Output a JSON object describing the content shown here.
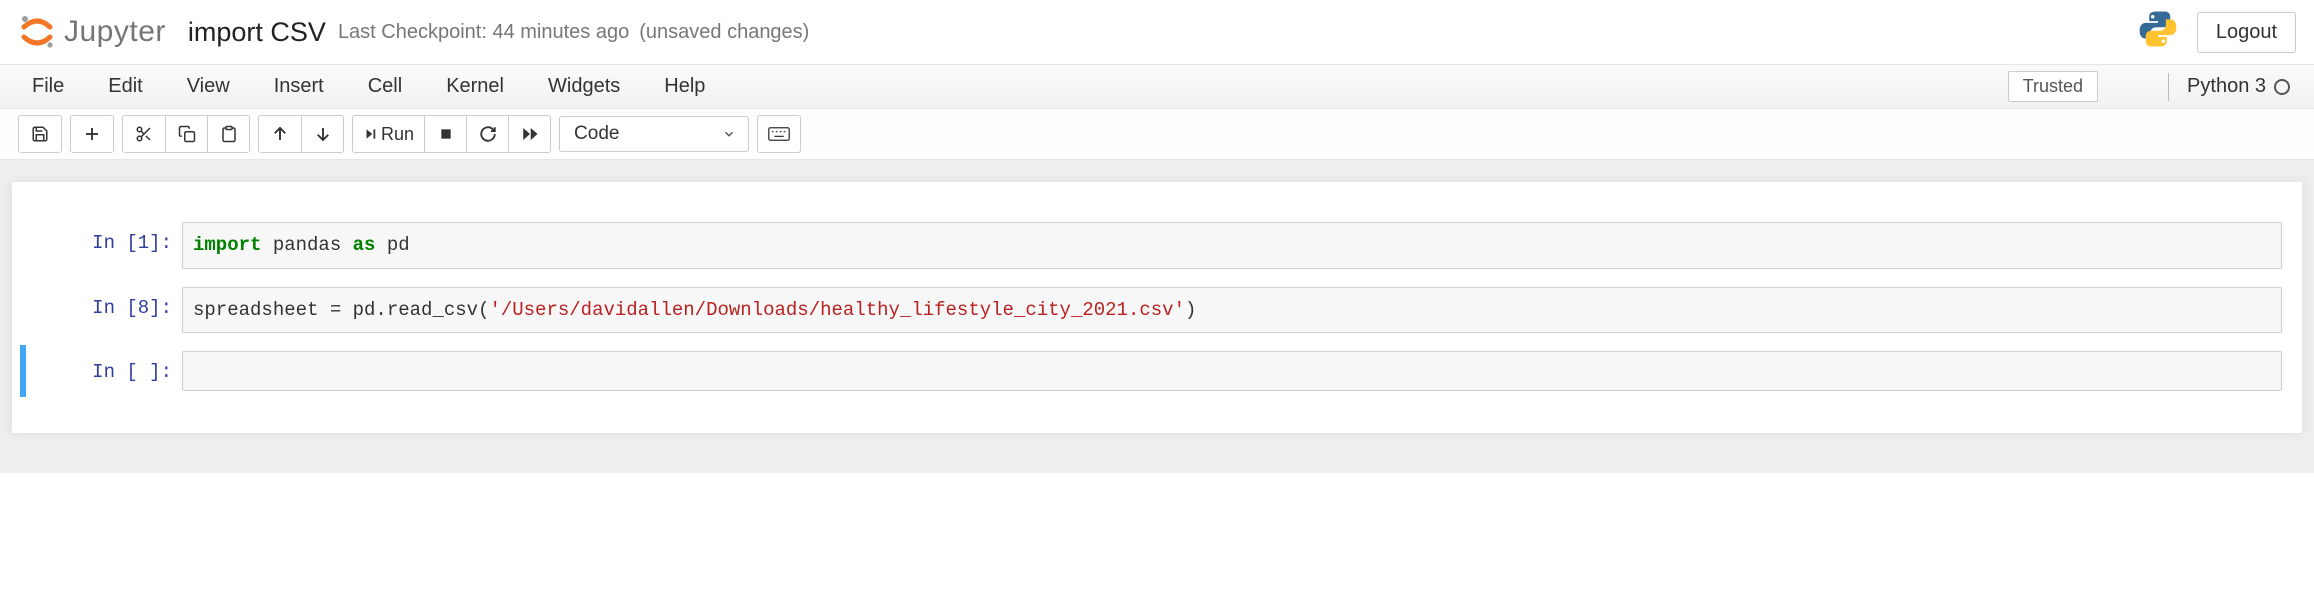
{
  "header": {
    "logo_text": "Jupyter",
    "notebook_title": "import CSV",
    "checkpoint": "Last Checkpoint: 44 minutes ago",
    "unsaved": "(unsaved changes)",
    "logout": "Logout"
  },
  "menubar": {
    "items": [
      "File",
      "Edit",
      "View",
      "Insert",
      "Cell",
      "Kernel",
      "Widgets",
      "Help"
    ],
    "trusted": "Trusted",
    "kernel_name": "Python 3"
  },
  "toolbar": {
    "run_label": "Run",
    "cell_type": "Code"
  },
  "cells": [
    {
      "prompt": "In [1]:",
      "tokens": [
        {
          "t": "import",
          "c": "kw"
        },
        {
          "t": " "
        },
        {
          "t": "pandas"
        },
        {
          "t": " "
        },
        {
          "t": "as",
          "c": "kw"
        },
        {
          "t": " "
        },
        {
          "t": "pd"
        }
      ]
    },
    {
      "prompt": "In [8]:",
      "tokens": [
        {
          "t": "spreadsheet = pd.read_csv("
        },
        {
          "t": "'/Users/davidallen/Downloads/healthy_lifestyle_city_2021.csv'",
          "c": "str"
        },
        {
          "t": ")"
        }
      ]
    },
    {
      "prompt": "In [ ]:",
      "tokens": [],
      "selected": true
    }
  ]
}
